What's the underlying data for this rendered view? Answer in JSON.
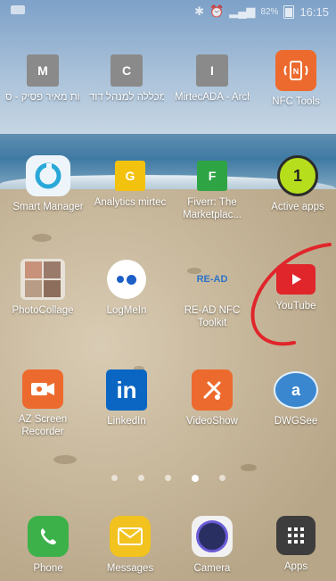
{
  "statusbar": {
    "time": "16:15",
    "battery": "82%"
  },
  "rows": [
    [
      {
        "id": "m",
        "label": "הרצאות מאיר פסיק - ס..."
      },
      {
        "id": "c",
        "label": "חשבונאות | מכללה למנהל דוד..."
      },
      {
        "id": "i",
        "label": "MirtecADA - Architectura..."
      },
      {
        "id": "nfc",
        "label": "NFC Tools"
      }
    ],
    [
      {
        "id": "smart",
        "label": "Smart Manager"
      },
      {
        "id": "analytics",
        "label": "Analytics mirtec"
      },
      {
        "id": "fiverr",
        "label": "Fiverr: The Marketplac..."
      },
      {
        "id": "active",
        "label": "Active apps"
      }
    ],
    [
      {
        "id": "photocollage",
        "label": "PhotoCollage"
      },
      {
        "id": "logmein",
        "label": "LogMeIn"
      },
      {
        "id": "readnfc",
        "label": "RE-AD NFC Toolkit"
      },
      {
        "id": "youtube",
        "label": "YouTube"
      }
    ],
    [
      {
        "id": "az",
        "label": "AZ Screen Recorder"
      },
      {
        "id": "linkedin",
        "label": "LinkedIn"
      },
      {
        "id": "videoshow",
        "label": "VideoShow"
      },
      {
        "id": "dwgsee",
        "label": "DWGSee"
      }
    ]
  ],
  "letters": {
    "m": "M",
    "c": "C",
    "i": "I",
    "analytics": "G",
    "fiverr": "F",
    "active": "1",
    "linkedin": "in",
    "nfc": "N"
  },
  "readnfc_logo": "RE-AD",
  "dock": [
    {
      "id": "phone",
      "label": "Phone"
    },
    {
      "id": "messages",
      "label": "Messages"
    },
    {
      "id": "camera",
      "label": "Camera"
    },
    {
      "id": "apps",
      "label": "Apps"
    }
  ],
  "pages": {
    "count": 5,
    "active": 4
  },
  "colors": {
    "accent_red": "#e0252b",
    "nfc_orange": "#ec6a2d",
    "linkedin_blue": "#0a66c2"
  }
}
